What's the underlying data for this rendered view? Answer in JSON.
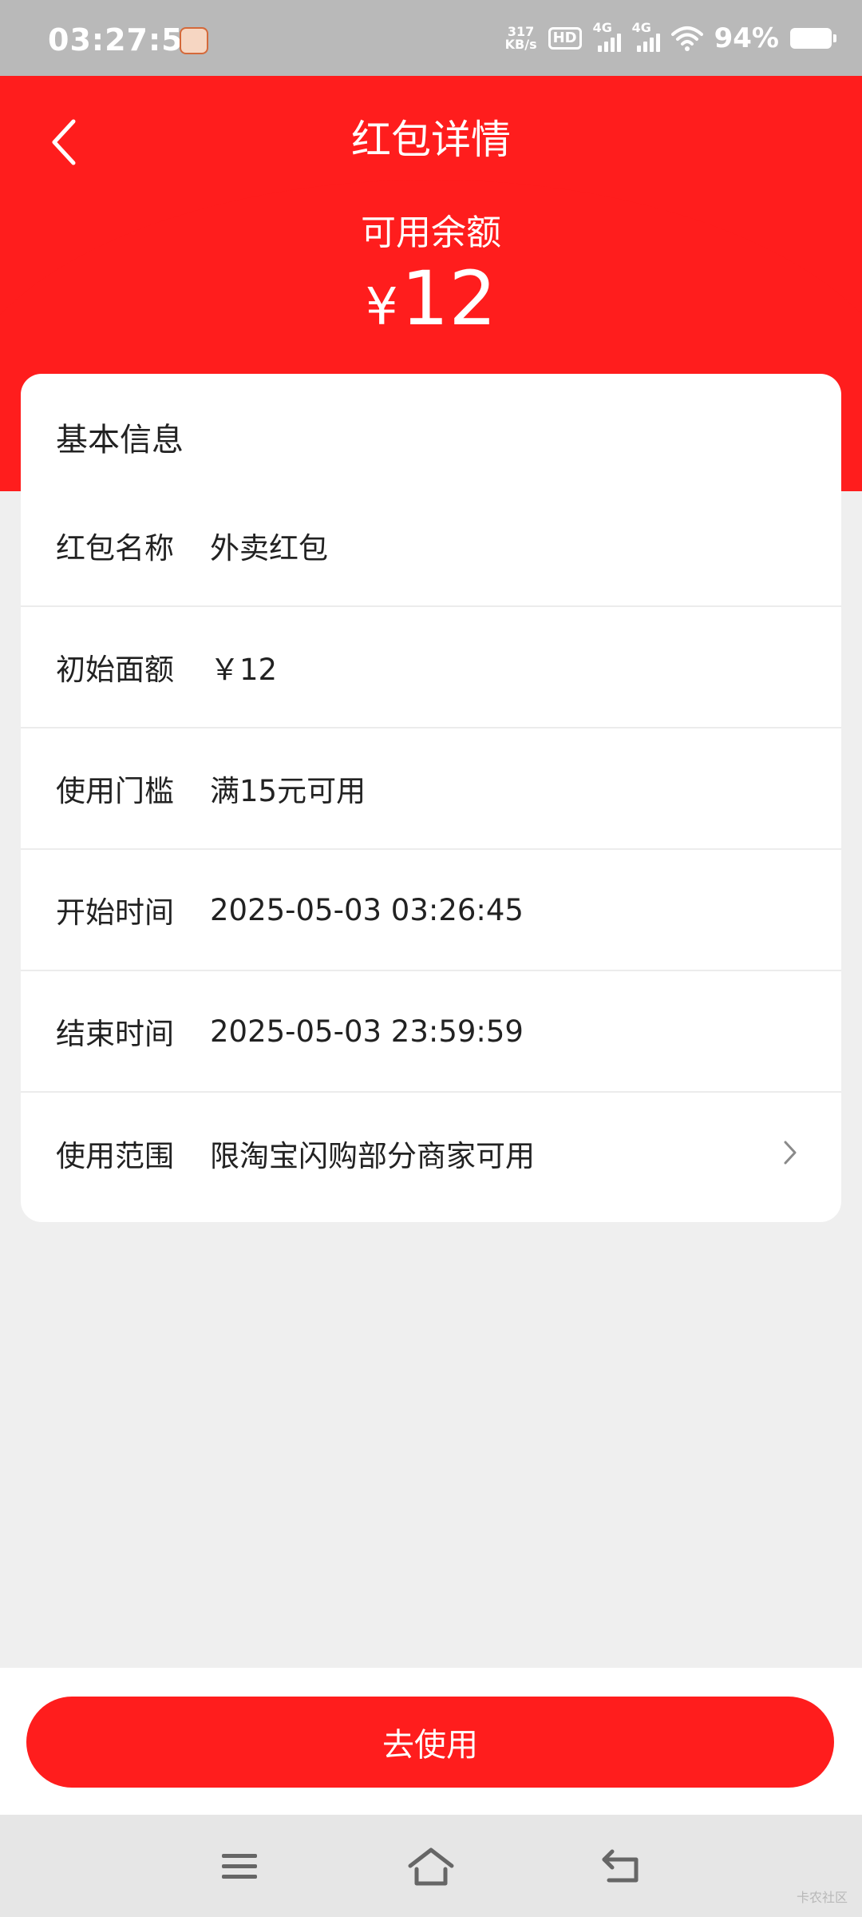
{
  "status_bar": {
    "time": "03:27:55",
    "net_speed_value": "317",
    "net_speed_unit": "KB/s",
    "hd_label": "HD",
    "sim1_label": "4G",
    "sim2_label": "4G",
    "battery": "94%"
  },
  "header": {
    "title": "红包详情",
    "balance_label": "可用余额",
    "balance_currency": "¥",
    "balance_value": "12"
  },
  "card": {
    "title": "基本信息",
    "rows": [
      {
        "label": "红包名称",
        "value": "外卖红包"
      },
      {
        "label": "初始面额",
        "value": "￥12"
      },
      {
        "label": "使用门槛",
        "value": "满15元可用"
      },
      {
        "label": "开始时间",
        "value": "2025-05-03 03:26:45"
      },
      {
        "label": "结束时间",
        "value": "2025-05-03 23:59:59"
      },
      {
        "label": "使用范围",
        "value": "限淘宝闪购部分商家可用"
      }
    ]
  },
  "footer": {
    "use_button_label": "去使用"
  },
  "watermark": "卡农社区",
  "colors": {
    "accent": "#ff1d1d",
    "background": "#efefef"
  }
}
